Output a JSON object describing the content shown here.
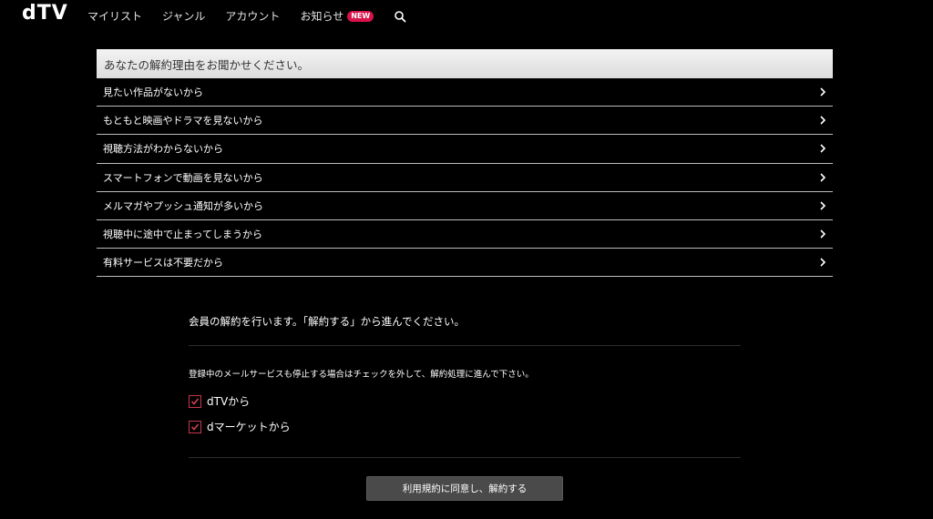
{
  "header": {
    "logo": "dTV",
    "nav": [
      {
        "label": "マイリスト"
      },
      {
        "label": "ジャンル"
      },
      {
        "label": "アカウント"
      },
      {
        "label": "お知らせ",
        "badge": "NEW"
      }
    ],
    "search_icon": "search-icon"
  },
  "reasons": {
    "title": "あなたの解約理由をお聞かせください。",
    "items": [
      {
        "label": "見たい作品がないから"
      },
      {
        "label": "もともと映画やドラマを見ないから"
      },
      {
        "label": "視聴方法がわからないから"
      },
      {
        "label": "スマートフォンで動画を見ないから"
      },
      {
        "label": "メルマガやプッシュ通知が多いから"
      },
      {
        "label": "視聴中に途中で止まってしまうから"
      },
      {
        "label": "有料サービスは不要だから"
      }
    ]
  },
  "confirm": {
    "message": "会員の解約を行います。「解約する」から進んでください。",
    "mail_note": "登録中のメールサービスも停止する場合はチェックを外して、解約処理に進んで下さい。",
    "options": [
      {
        "label": "dTVから",
        "checked": true
      },
      {
        "label": "dマーケットから",
        "checked": true
      }
    ],
    "button": "利用規約に同意し、解約する"
  },
  "colors": {
    "background": "#000000",
    "badge": "#d8124a",
    "checkbox": "#c8364e",
    "button": "#4a4a4a"
  }
}
